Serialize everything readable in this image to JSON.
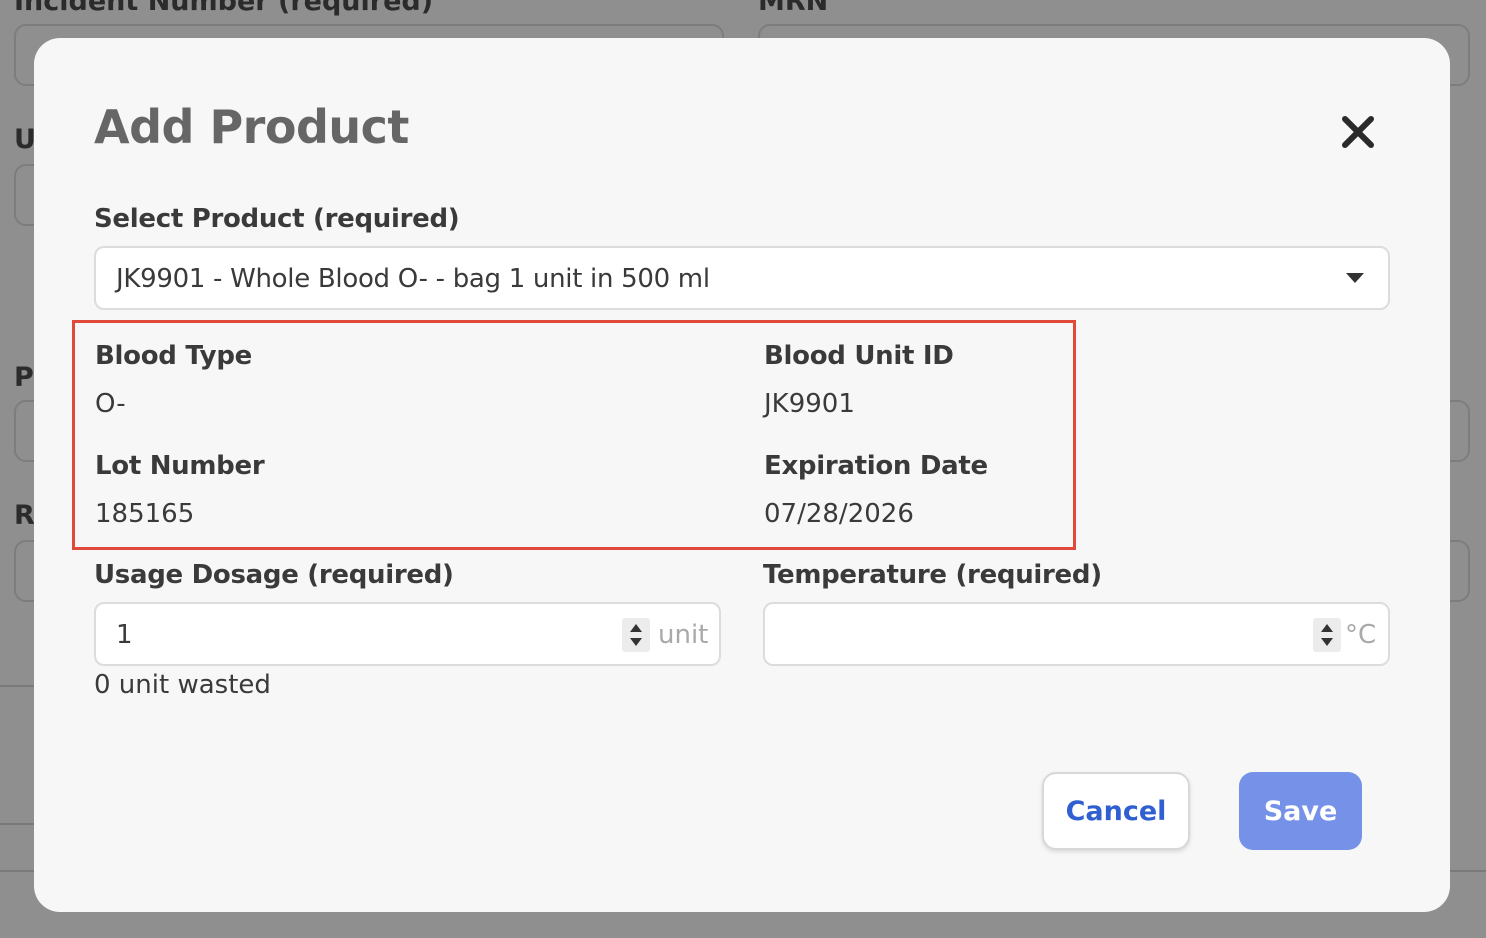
{
  "background_form": {
    "label_incident": "Incident Number (required)",
    "label_mrn": "MRN",
    "label_u": "U",
    "label_p": "Pr",
    "label_r": "R"
  },
  "modal": {
    "title": "Add Product",
    "close_icon": "close-icon",
    "select_product": {
      "label": "Select Product (required)",
      "value": "JK9901 - Whole Blood O- - bag 1 unit in 500 ml"
    },
    "details": {
      "blood_type": {
        "label": "Blood Type",
        "value": "O-"
      },
      "blood_unit_id": {
        "label": "Blood Unit ID",
        "value": "JK9901"
      },
      "lot_number": {
        "label": "Lot Number",
        "value": "185165"
      },
      "expiration_date": {
        "label": "Expiration Date",
        "value": "07/28/2026"
      }
    },
    "usage_dosage": {
      "label": "Usage Dosage (required)",
      "value": "1",
      "unit": "unit",
      "helper": "0 unit wasted"
    },
    "temperature": {
      "label": "Temperature (required)",
      "value": "",
      "unit": "°C"
    },
    "buttons": {
      "cancel": "Cancel",
      "save": "Save"
    }
  },
  "colors": {
    "highlight_border": "#e04a3a",
    "primary_text": "#2f5fd0",
    "save_bg": "#7592e8"
  }
}
